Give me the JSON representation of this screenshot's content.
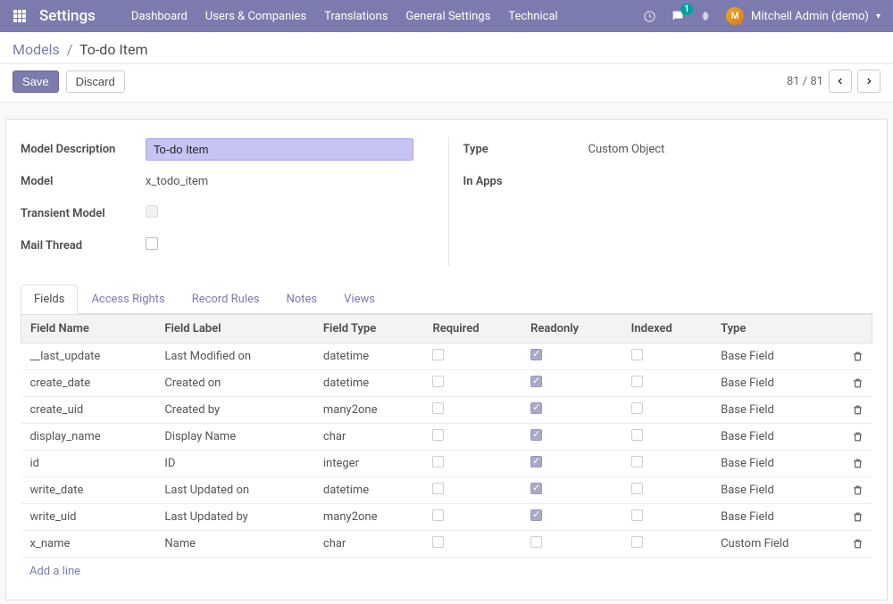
{
  "nav": {
    "app_title": "Settings",
    "menu": [
      "Dashboard",
      "Users & Companies",
      "Translations",
      "General Settings",
      "Technical"
    ],
    "chat_badge": "1",
    "user_name": "Mitchell Admin (demo)"
  },
  "breadcrumb": {
    "root": "Models",
    "sep": "/",
    "current": "To-do Item"
  },
  "actions": {
    "save": "Save",
    "discard": "Discard",
    "pager_text": "81 / 81"
  },
  "form": {
    "left": {
      "model_description_label": "Model Description",
      "model_description_value": "To-do Item",
      "model_label": "Model",
      "model_value": "x_todo_item",
      "transient_label": "Transient Model",
      "mail_thread_label": "Mail Thread"
    },
    "right": {
      "type_label": "Type",
      "type_value": "Custom Object",
      "in_apps_label": "In Apps",
      "in_apps_value": ""
    }
  },
  "tabs": [
    "Fields",
    "Access Rights",
    "Record Rules",
    "Notes",
    "Views"
  ],
  "table": {
    "headers": {
      "field_name": "Field Name",
      "field_label": "Field Label",
      "field_type": "Field Type",
      "required": "Required",
      "readonly": "Readonly",
      "indexed": "Indexed",
      "type": "Type"
    },
    "rows": [
      {
        "name": "__last_update",
        "label": "Last Modified on",
        "ftype": "datetime",
        "required": false,
        "readonly": true,
        "indexed": false,
        "type": "Base Field"
      },
      {
        "name": "create_date",
        "label": "Created on",
        "ftype": "datetime",
        "required": false,
        "readonly": true,
        "indexed": false,
        "type": "Base Field"
      },
      {
        "name": "create_uid",
        "label": "Created by",
        "ftype": "many2one",
        "required": false,
        "readonly": true,
        "indexed": false,
        "type": "Base Field"
      },
      {
        "name": "display_name",
        "label": "Display Name",
        "ftype": "char",
        "required": false,
        "readonly": true,
        "indexed": false,
        "type": "Base Field"
      },
      {
        "name": "id",
        "label": "ID",
        "ftype": "integer",
        "required": false,
        "readonly": true,
        "indexed": false,
        "type": "Base Field"
      },
      {
        "name": "write_date",
        "label": "Last Updated on",
        "ftype": "datetime",
        "required": false,
        "readonly": true,
        "indexed": false,
        "type": "Base Field"
      },
      {
        "name": "write_uid",
        "label": "Last Updated by",
        "ftype": "many2one",
        "required": false,
        "readonly": true,
        "indexed": false,
        "type": "Base Field"
      },
      {
        "name": "x_name",
        "label": "Name",
        "ftype": "char",
        "required": false,
        "readonly": false,
        "indexed": false,
        "type": "Custom Field"
      }
    ],
    "add_line": "Add a line"
  }
}
